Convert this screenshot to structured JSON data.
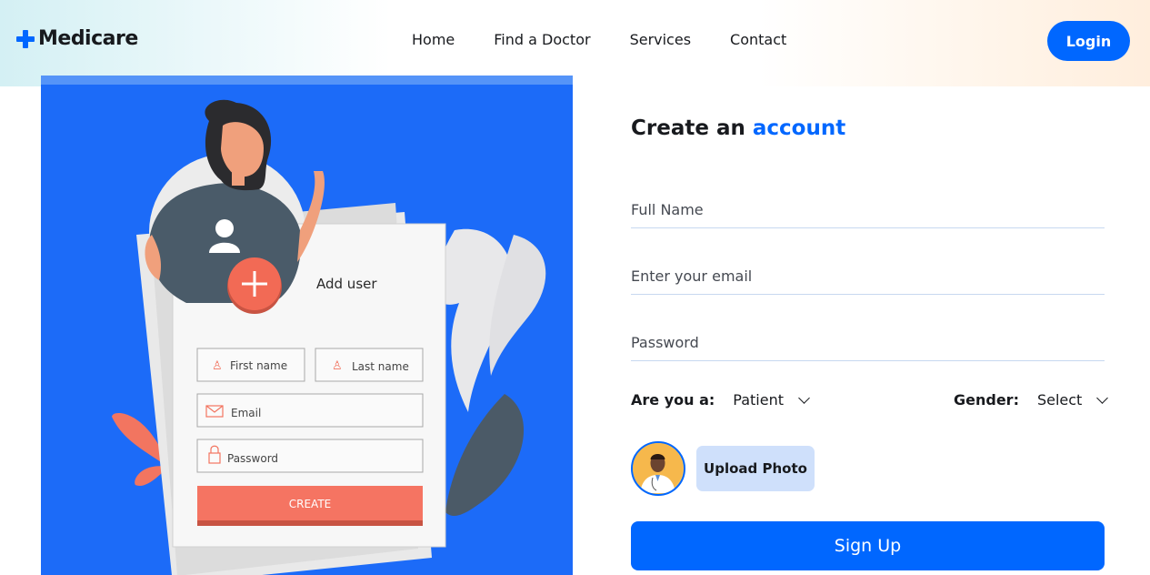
{
  "brand": {
    "name": "Medicare",
    "icon": "plus-icon",
    "color": "#0067ff"
  },
  "nav": {
    "items": [
      "Home",
      "Find a Doctor",
      "Services",
      "Contact"
    ]
  },
  "header": {
    "login_label": "Login"
  },
  "illustration": {
    "card_title": "Add user",
    "first_name_placeholder": "First name",
    "last_name_placeholder": "Last name",
    "email_placeholder": "Email",
    "password_placeholder": "Password",
    "create_label": "CREATE",
    "background_color": "#1c6bf8"
  },
  "signup": {
    "title_prefix": "Create an",
    "title_accent": "account",
    "full_name_placeholder": "Full Name",
    "email_placeholder": "Enter your email",
    "password_placeholder": "Password",
    "role_label": "Are you a:",
    "role_value": "Patient",
    "gender_label": "Gender:",
    "gender_value": "Select",
    "upload_label": "Upload Photo",
    "submit_label": "Sign Up"
  }
}
